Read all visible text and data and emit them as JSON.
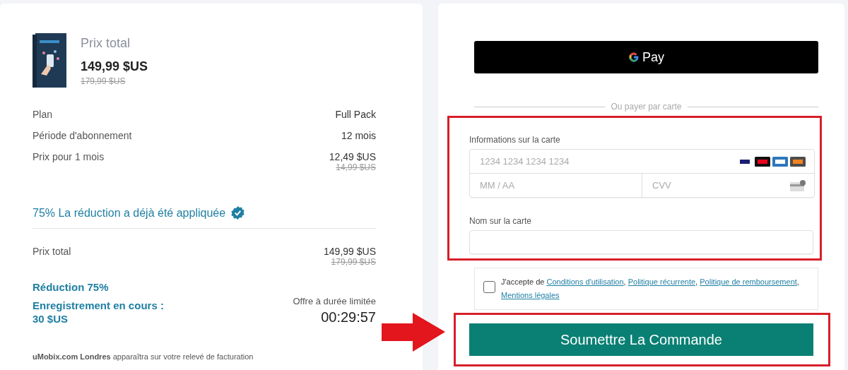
{
  "summary": {
    "title": "Prix total",
    "price": "149,99 $US",
    "old_price": "179,99 $US",
    "rows": [
      {
        "label": "Plan",
        "value": "Full Pack"
      },
      {
        "label": "Période d'abonnement",
        "value": "12 mois"
      },
      {
        "label": "Prix pour 1 mois",
        "value": "12,49 $US",
        "old_value": "14,99 $US"
      }
    ],
    "discount_note": "75% La réduction a déjà été appliquée",
    "total": {
      "label": "Prix total",
      "value": "149,99 $US",
      "old_value": "179,99 $US"
    },
    "reduction": "Réduction 75%",
    "saving": "Enregistrement en cours :\n30 $US",
    "offer_label": "Offre à durée limitée",
    "timer": "00:29:57",
    "footer": "**uMobix.com Londres** apparaîtra sur votre relevé de facturation"
  },
  "payment": {
    "gpay_label": "Pay",
    "divider": "Ou payer par carte",
    "card_label": "Informations sur la carte",
    "card_number_placeholder": "1234 1234 1234 1234",
    "expiry_placeholder": "MM / AA",
    "cvv_placeholder": "CVV",
    "name_label": "Nom sur la carte",
    "terms": {
      "checked": false,
      "parts": [
        {
          "kind": "text",
          "text": "J'accepte de "
        },
        {
          "kind": "link",
          "text": "Conditions d'utilisation"
        },
        {
          "kind": "text",
          "text": ", "
        },
        {
          "kind": "link",
          "text": "Politique récurrente"
        },
        {
          "kind": "text",
          "text": ", "
        },
        {
          "kind": "link",
          "text": "Politique de remboursement"
        },
        {
          "kind": "text",
          "text": ", "
        },
        {
          "kind": "link",
          "text": "Mentions légales"
        }
      ]
    },
    "submit": "Soumettre La Commande"
  }
}
